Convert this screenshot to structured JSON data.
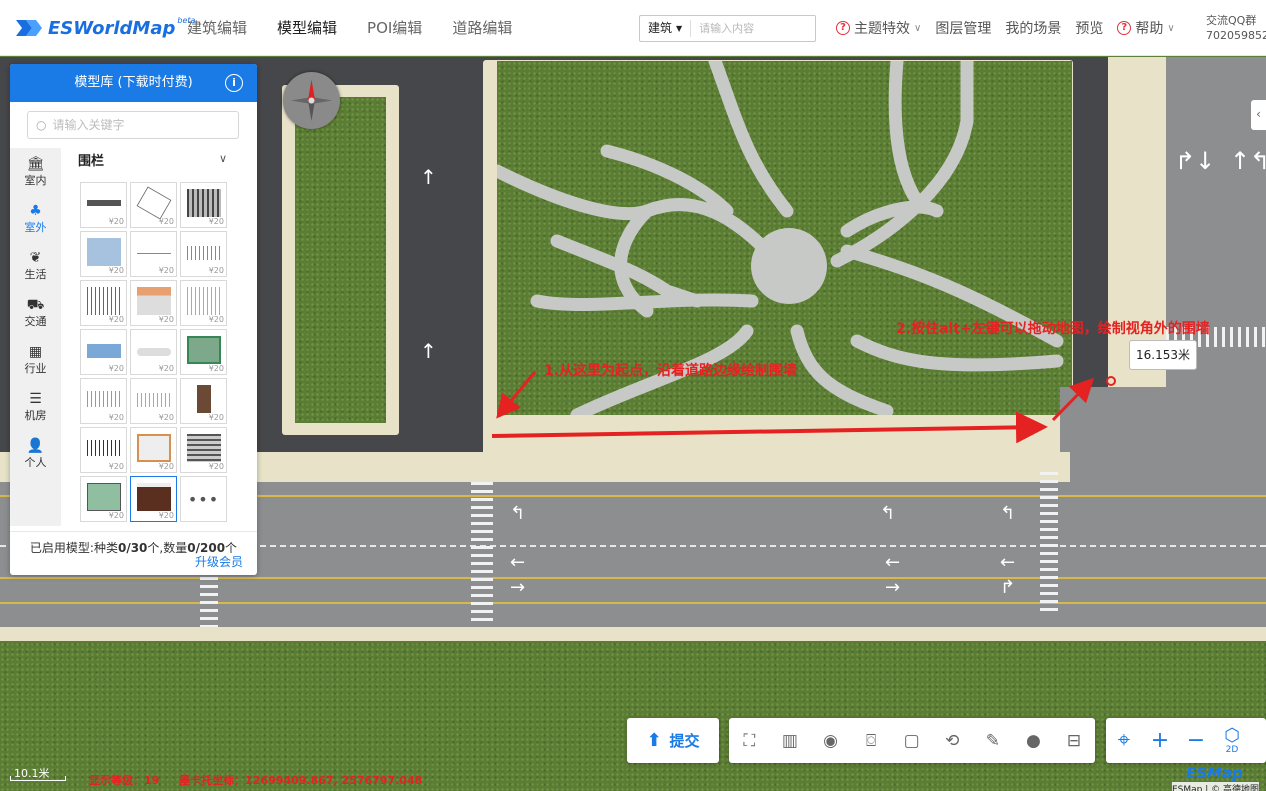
{
  "header": {
    "logo_text": "ESWorldMap",
    "logo_badge": "beta",
    "nav": [
      "建筑编辑",
      "模型编辑",
      "POI编辑",
      "道路编辑"
    ],
    "active_nav": "模型编辑",
    "search": {
      "type": "建筑",
      "placeholder": "请输入内容"
    },
    "menu": {
      "theme": "主题特效",
      "layers": "图层管理",
      "scenes": "我的场景",
      "preview": "预览",
      "help": "帮助"
    },
    "qq_line1": "交流QQ群",
    "qq_line2": "702059852"
  },
  "panel": {
    "title": "模型库 (下载时付费)",
    "search_placeholder": "请输入关键字",
    "categories": [
      {
        "label": "室内",
        "icon": "building-icon"
      },
      {
        "label": "室外",
        "icon": "trees-icon"
      },
      {
        "label": "生活",
        "icon": "plant-icon"
      },
      {
        "label": "交通",
        "icon": "car-icon"
      },
      {
        "label": "行业",
        "icon": "industry-icon"
      },
      {
        "label": "机房",
        "icon": "server-icon"
      },
      {
        "label": "个人",
        "icon": "person-icon"
      }
    ],
    "active_category": "室外",
    "group_title": "围栏",
    "price": "¥20",
    "more": "•••",
    "footer_prefix": "已启用模型:种类",
    "kinds_used": "0",
    "kinds_total": "/30",
    "footer_mid": "个,数量",
    "count_used": "0",
    "count_total": "/200",
    "footer_suffix": "个",
    "upgrade": "升级会员"
  },
  "map": {
    "annotation_1": "1.从这里为起点，沿着道路边缘绘制围墙",
    "annotation_2": "2.按住alt+左键可以拖动地图，绘制视角外的围墙",
    "measurement": "16.153米"
  },
  "toolbar": {
    "submit": "提交",
    "mode": "2D"
  },
  "status": {
    "scale": "10.1米",
    "level": "显示等级：19",
    "coords": "墨卡托坐标：12699409.867, 2576797.048"
  },
  "footer": {
    "brand": "ESMap",
    "copyright": "ESMap | © 高德地图"
  },
  "colors": {
    "accent": "#1a7be6",
    "annotation": "#e52222"
  }
}
